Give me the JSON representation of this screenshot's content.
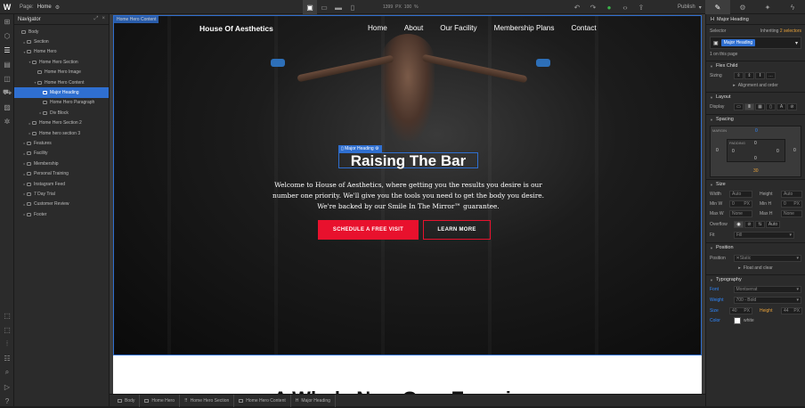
{
  "topbar": {
    "logo": "W",
    "page_label": "Page:",
    "page_name": "Home",
    "width_value": "1399",
    "width_unit": "PX",
    "zoom": "100",
    "zoom_unit": "%",
    "publish_label": "Publish"
  },
  "navigator": {
    "title": "Navigator",
    "items": [
      {
        "label": "Body",
        "indent": 0,
        "caret": ""
      },
      {
        "label": "Section",
        "indent": 1,
        "caret": "▸"
      },
      {
        "label": "Home Hero",
        "indent": 1,
        "caret": "▾"
      },
      {
        "label": "Home Hero Section",
        "indent": 2,
        "caret": "▾"
      },
      {
        "label": "Home Hero Image",
        "indent": 3,
        "caret": ""
      },
      {
        "label": "Home Hero Content",
        "indent": 3,
        "caret": "▾"
      },
      {
        "label": "Major Heading",
        "indent": 4,
        "caret": "",
        "selected": true
      },
      {
        "label": "Home Hero Paragraph",
        "indent": 4,
        "caret": ""
      },
      {
        "label": "Div Block",
        "indent": 4,
        "caret": "▸"
      },
      {
        "label": "Home Hero Section 2",
        "indent": 2,
        "caret": "▸"
      },
      {
        "label": "Home hero section 3",
        "indent": 2,
        "caret": "▸"
      },
      {
        "label": "Features",
        "indent": 1,
        "caret": "▸"
      },
      {
        "label": "Facility",
        "indent": 1,
        "caret": "▸"
      },
      {
        "label": "Membership",
        "indent": 1,
        "caret": "▸"
      },
      {
        "label": "Personal Training",
        "indent": 1,
        "caret": "▸"
      },
      {
        "label": "Instagram Feed",
        "indent": 1,
        "caret": "▸"
      },
      {
        "label": "7 Day Trial",
        "indent": 1,
        "caret": "▸"
      },
      {
        "label": "Customer Review",
        "indent": 1,
        "caret": "▸"
      },
      {
        "label": "Footer",
        "indent": 1,
        "caret": "▸"
      }
    ]
  },
  "canvas": {
    "hero_tag": "Home Hero Content",
    "brand": "House Of Aesthetics",
    "menu": [
      "Home",
      "About",
      "Our Facility",
      "Membership Plans",
      "Contact"
    ],
    "heading_tag": "Major Heading",
    "heading": "Raising The Bar",
    "paragraph_lines": [
      "Welcome to House of Aesthetics, where getting you the results you desire is our",
      "number one priority. We'll give you the tools you need to get the body you desire.",
      "We're backed by our Smile In The Mirror™ guarantee."
    ],
    "cta_primary": "SCHEDULE A FREE VISIT",
    "cta_secondary": "LEARN MORE",
    "next_heading": "A Whole New Gym Experience",
    "accent_color": "#e8112d",
    "selection_color": "#2f6fd0"
  },
  "breadcrumb": [
    "Body",
    "Home Hero",
    "Home Hero Section",
    "Home Hero Content",
    "Major Heading"
  ],
  "style_panel": {
    "title": "Major Heading",
    "selector_label": "Selector",
    "inheriting_text": "Inheriting",
    "inheriting_count": "2 selectors",
    "selector_chip": "Major Heading",
    "on_page": "1 on this page",
    "flex_child": {
      "title": "Flex Child",
      "sizing_label": "Sizing",
      "align_link": "Alignment and order"
    },
    "layout": {
      "title": "Layout",
      "display_label": "Display"
    },
    "spacing": {
      "title": "Spacing",
      "margin_label": "MARGIN",
      "padding_label": "PADDING",
      "values": {
        "m_top": "0",
        "m_left": "0",
        "m_right": "0",
        "m_bottom": "30",
        "p_top": "0",
        "p_left": "0",
        "p_right": "0",
        "p_bottom": "0"
      }
    },
    "size": {
      "title": "Size",
      "width_label": "Width",
      "width_val": "Auto",
      "height_label": "Height",
      "height_val": "Auto",
      "minw_label": "Min W",
      "minw_val": "0",
      "minw_unit": "PX",
      "minh_label": "Min H",
      "minh_val": "0",
      "minh_unit": "PX",
      "maxw_label": "Max W",
      "maxw_val": "None",
      "maxh_label": "Max H",
      "maxh_val": "None",
      "overflow_label": "Overflow",
      "overflow_auto": "Auto",
      "fit_label": "Fit",
      "fit_val": "Fill"
    },
    "position": {
      "title": "Position",
      "label": "Position",
      "value": "Static",
      "float_link": "Float and clear"
    },
    "typography": {
      "title": "Typography",
      "font_label": "Font",
      "font_val": "Montserrat",
      "weight_label": "Weight",
      "weight_val": "700 - Bold",
      "size_label": "Size",
      "size_val": "40",
      "size_unit": "PX",
      "height_label": "Height",
      "height_val": "44",
      "height_unit": "PX",
      "color_label": "Color",
      "color_val": "white"
    }
  }
}
